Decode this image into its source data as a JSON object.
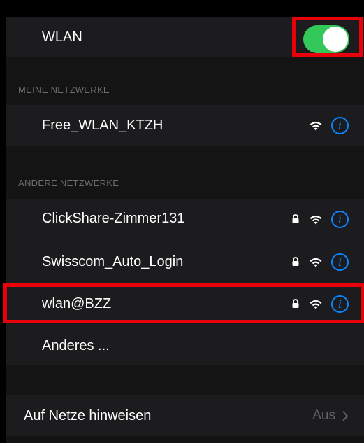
{
  "wlan": {
    "label": "WLAN",
    "enabled": true
  },
  "sections": {
    "my_networks": "MEINE NETZWERKE",
    "other_networks": "ANDERE NETZWERKE"
  },
  "my_networks": [
    {
      "name": "Free_WLAN_KTZH",
      "secured": false
    }
  ],
  "other_networks": [
    {
      "name": "ClickShare-Zimmer131",
      "secured": true
    },
    {
      "name": "Swisscom_Auto_Login",
      "secured": true
    },
    {
      "name": "wlan@BZZ",
      "secured": true
    }
  ],
  "other_option": "Anderes ...",
  "ask_to_join": {
    "label": "Auf Netze hinweisen",
    "value": "Aus"
  },
  "icons": {
    "lock": "lock-icon",
    "wifi": "wifi-icon",
    "info": "info-icon",
    "chevron": "chevron-right-icon"
  },
  "colors": {
    "toggle_on": "#34c759",
    "info_blue": "#0a84ff",
    "highlight_red": "#e8000b"
  }
}
